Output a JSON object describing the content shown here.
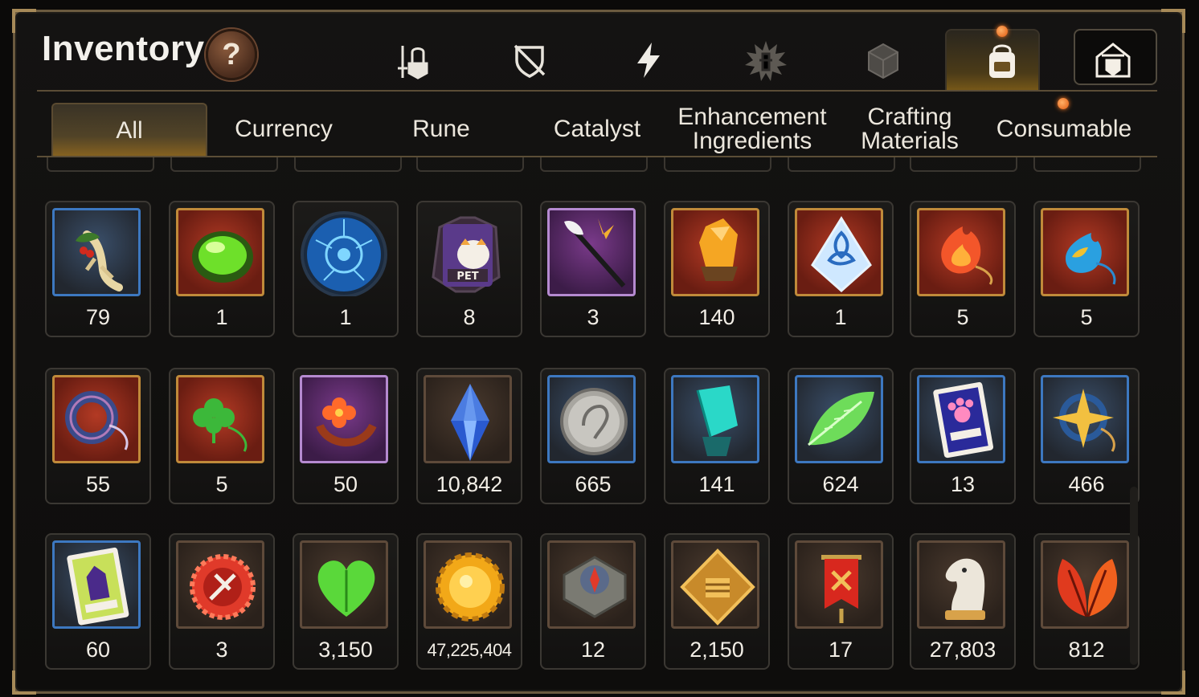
{
  "header": {
    "title": "Inventory",
    "help_label": "?"
  },
  "category_icons": [
    {
      "name": "attack-gear-icon"
    },
    {
      "name": "shield-crossed-icon"
    },
    {
      "name": "lightning-icon"
    },
    {
      "name": "rune-burst-icon"
    },
    {
      "name": "dice-box-icon"
    },
    {
      "name": "backpack-icon",
      "active": true
    },
    {
      "name": "house-shield-icon"
    }
  ],
  "tabs": [
    {
      "label": "All",
      "active": true
    },
    {
      "label": "Currency"
    },
    {
      "label": "Rune"
    },
    {
      "label": "Catalyst"
    },
    {
      "label": "Enhancement Ingredients"
    },
    {
      "label": "Crafting Materials"
    },
    {
      "label": "Consumable"
    }
  ],
  "items": [
    [
      {
        "icon": "ginseng-root-icon",
        "quantity": "79"
      },
      {
        "icon": "green-orb-icon",
        "quantity": "1"
      },
      {
        "icon": "blue-circuit-disc-icon",
        "quantity": "1"
      },
      {
        "icon": "pet-food-bag-icon",
        "quantity": "8"
      },
      {
        "icon": "feather-wand-icon",
        "quantity": "3"
      },
      {
        "icon": "amber-crystal-icon",
        "quantity": "140"
      },
      {
        "icon": "triquetra-crystal-icon",
        "quantity": "1"
      },
      {
        "icon": "fire-pendant-icon",
        "quantity": "5"
      },
      {
        "icon": "water-pendant-icon",
        "quantity": "5"
      }
    ],
    [
      {
        "icon": "ring-pendant-icon",
        "quantity": "55"
      },
      {
        "icon": "clover-pendant-icon",
        "quantity": "5"
      },
      {
        "icon": "flower-ring-icon",
        "quantity": "50"
      },
      {
        "icon": "blue-crystal-icon",
        "quantity": "10,842"
      },
      {
        "icon": "silver-coin-icon",
        "quantity": "665"
      },
      {
        "icon": "teal-crystal-icon",
        "quantity": "141"
      },
      {
        "icon": "green-leaf-icon",
        "quantity": "624"
      },
      {
        "icon": "paw-card-icon",
        "quantity": "13"
      },
      {
        "icon": "star-pendant-icon",
        "quantity": "466"
      }
    ],
    [
      {
        "icon": "costume-card-icon",
        "quantity": "60"
      },
      {
        "icon": "red-badge-icon",
        "quantity": "3"
      },
      {
        "icon": "green-heart-icon",
        "quantity": "3,150"
      },
      {
        "icon": "gold-sun-coin-icon",
        "quantity": "47,225,404"
      },
      {
        "icon": "stone-compass-icon",
        "quantity": "12"
      },
      {
        "icon": "fist-emblem-icon",
        "quantity": "2,150"
      },
      {
        "icon": "red-banner-icon",
        "quantity": "17"
      },
      {
        "icon": "knight-chess-icon",
        "quantity": "27,803"
      },
      {
        "icon": "red-leaves-icon",
        "quantity": "812"
      }
    ]
  ],
  "colors": {
    "frame": "#6b5a3f",
    "accent_gold": "#c08a3a",
    "notify": "#ff7a22"
  }
}
